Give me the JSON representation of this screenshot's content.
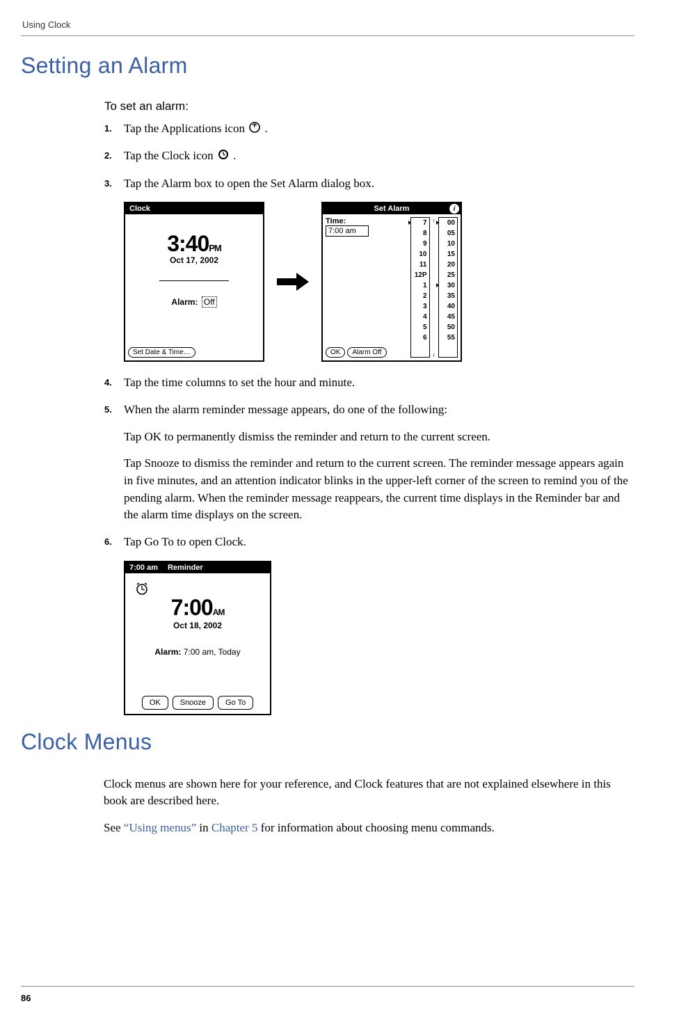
{
  "header": {
    "chapter": "Using Clock"
  },
  "section1": {
    "title": "Setting an Alarm",
    "subtitle": "To set an alarm:"
  },
  "steps": {
    "s1": {
      "num": "1.",
      "text_before": "Tap the Applications icon ",
      "text_after": "."
    },
    "s2": {
      "num": "2.",
      "text_before": "Tap the Clock icon ",
      "text_after": "."
    },
    "s3": {
      "num": "3.",
      "text": "Tap the Alarm box to open the Set Alarm dialog box."
    },
    "s4": {
      "num": "4.",
      "text": "Tap the time columns to set the hour and minute."
    },
    "s5": {
      "num": "5.",
      "p1": "When the alarm reminder message appears, do one of the following:",
      "p2": "Tap OK to permanently dismiss the reminder and return to the current screen.",
      "p3": "Tap Snooze to dismiss the reminder and return to the current screen. The reminder message appears again in five minutes, and an attention indicator blinks in the upper-left corner of the screen to remind you of the pending alarm. When the reminder message reappears, the current time displays in the Reminder bar and the alarm time displays on the screen."
    },
    "s6": {
      "num": "6.",
      "text": "Tap Go To to open Clock."
    }
  },
  "fig_clock": {
    "title": "Clock",
    "time": "3:40",
    "ampm": "PM",
    "date": "Oct 17, 2002",
    "alarm_label": "Alarm:",
    "alarm_value": "Off",
    "button": "Set Date & Time…"
  },
  "fig_setalarm": {
    "title": "Set Alarm",
    "time_label": "Time:",
    "time_value": "7:00 am",
    "ok": "OK",
    "alarm_off": "Alarm Off",
    "hours": [
      "7",
      "8",
      "9",
      "10",
      "11",
      "12P",
      "1",
      "2",
      "3",
      "4",
      "5",
      "6"
    ],
    "hour_up": "↑",
    "hour_down": "↓",
    "minutes": [
      "00",
      "05",
      "10",
      "15",
      "20",
      "25",
      "30",
      "35",
      "40",
      "45",
      "50",
      "55"
    ],
    "selected_hour": "7",
    "selected_minute_a": "00",
    "selected_minute_b": "30"
  },
  "fig_reminder": {
    "header_time": "7:00 am",
    "header_label": "Reminder",
    "time": "7:00",
    "ampm": "AM",
    "date": "Oct 18, 2002",
    "alarm_label": "Alarm:",
    "alarm_value": "7:00 am, Today",
    "ok": "OK",
    "snooze": "Snooze",
    "goto": "Go To"
  },
  "section2": {
    "title": "Clock Menus",
    "p1": "Clock menus are shown here for your reference, and Clock features that are not explained elsewhere in this book are described here.",
    "p2_a": "See ",
    "p2_link1": "“Using menus”",
    "p2_b": " in ",
    "p2_link2": "Chapter 5",
    "p2_c": " for information about choosing menu commands."
  },
  "page_number": "86"
}
